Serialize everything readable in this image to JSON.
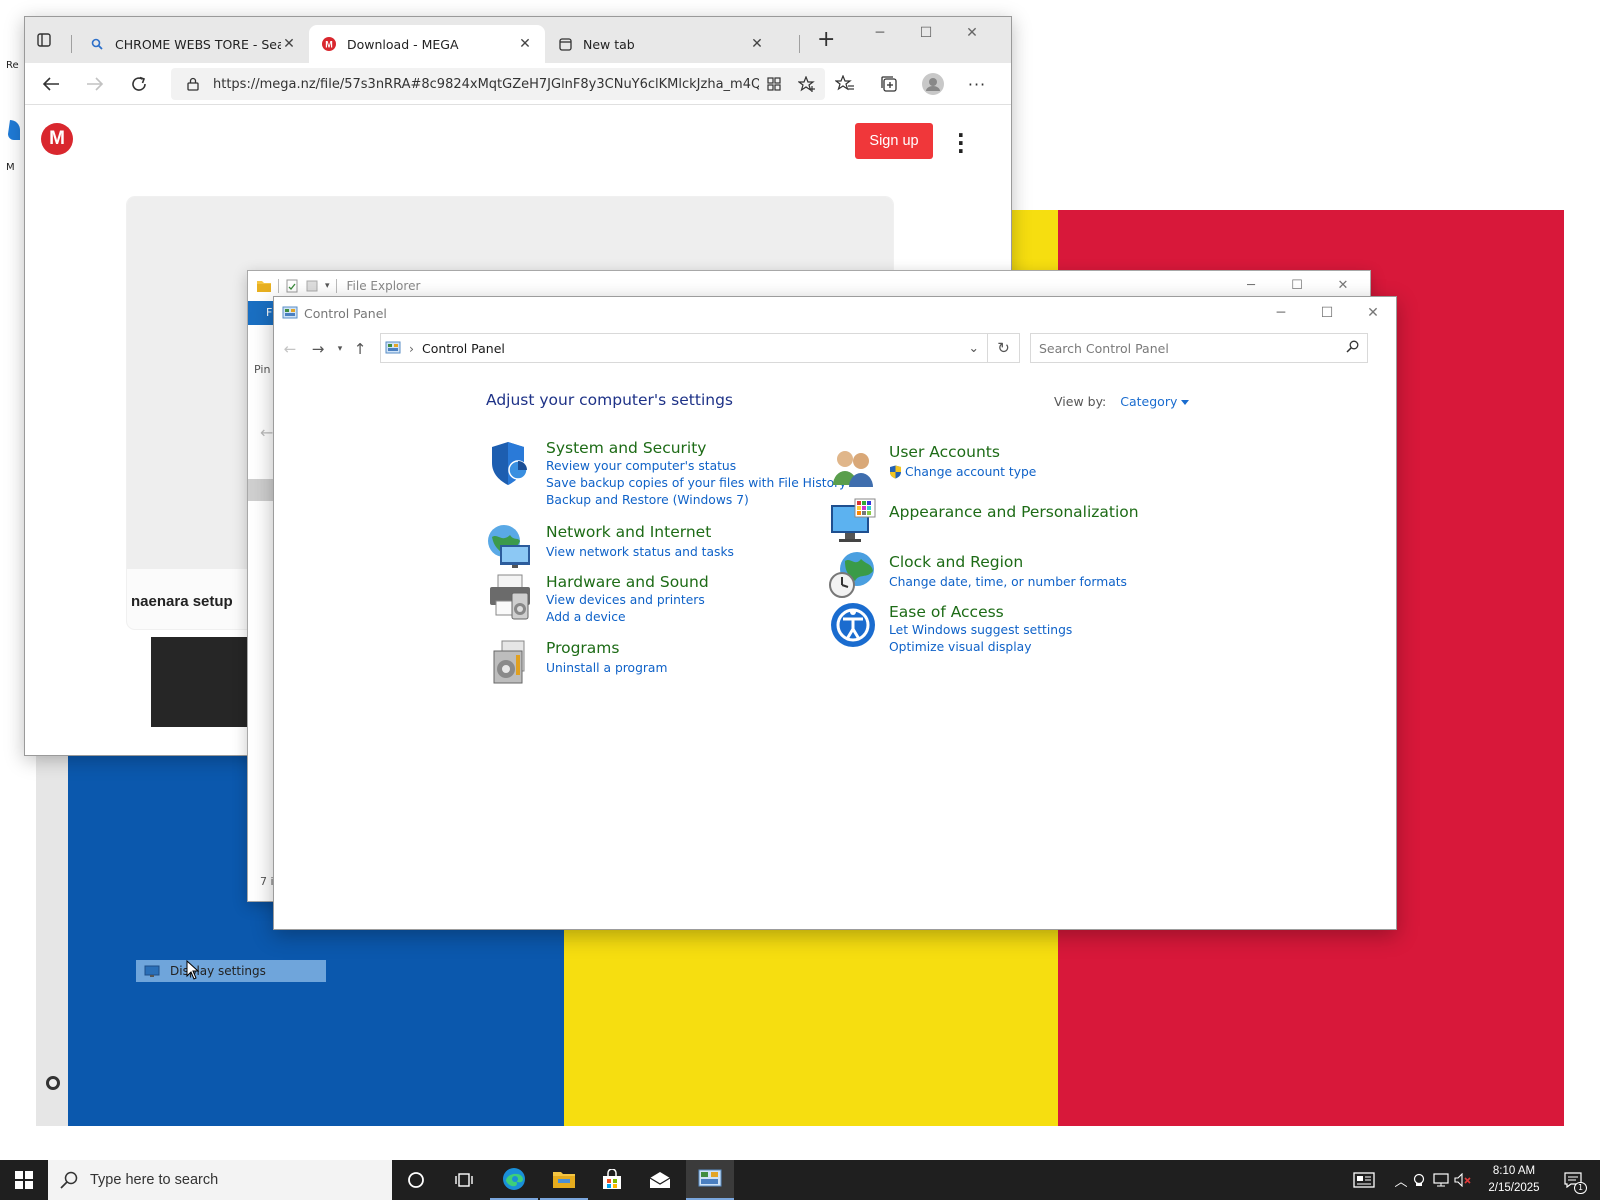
{
  "browser": {
    "tabs": [
      {
        "title": "CHROME WEBS TORE - Search",
        "close": "✕"
      },
      {
        "title": "Download - MEGA",
        "close": "✕"
      },
      {
        "title": "New tab",
        "close": "✕"
      }
    ],
    "new_tab": "+",
    "url": "https://mega.nz/file/57s3nRRA#8c9824xMqtGZeH7JGlnF8y3CNuY6clKMlckJzha_m4Q",
    "page": {
      "logo_letter": "M",
      "signup_label": "Sign up",
      "file_name": "naenara setup"
    }
  },
  "explorer": {
    "title": "File Explorer",
    "ribbon_tab_fragment": "F",
    "pin_fragment": "Pin",
    "status_fragment": "7 i"
  },
  "control_panel": {
    "title": "Control Panel",
    "breadcrumb": "Control Panel",
    "search_placeholder": "Search Control Panel",
    "heading": "Adjust your computer's settings",
    "view_by_label": "View by:",
    "view_by_value": "Category",
    "categories_left": [
      {
        "title": "System and Security",
        "links": [
          "Review your computer's status",
          "Save backup copies of your files with File History",
          "Backup and Restore (Windows 7)"
        ]
      },
      {
        "title": "Network and Internet",
        "links": [
          "View network status and tasks"
        ]
      },
      {
        "title": "Hardware and Sound",
        "links": [
          "View devices and printers",
          "Add a device"
        ]
      },
      {
        "title": "Programs",
        "links": [
          "Uninstall a program"
        ]
      }
    ],
    "categories_right": [
      {
        "title": "User Accounts",
        "links": [
          "Change account type"
        ]
      },
      {
        "title": "Appearance and Personalization",
        "links": []
      },
      {
        "title": "Clock and Region",
        "links": [
          "Change date, time, or number formats"
        ]
      },
      {
        "title": "Ease of Access",
        "links": [
          "Let Windows suggest settings",
          "Optimize visual display"
        ]
      }
    ]
  },
  "desktop": {
    "drag_label": "Display settings",
    "icon_fragments": [
      "Re",
      "M"
    ]
  },
  "taskbar": {
    "search_placeholder": "Type here to search",
    "time": "8:10 AM",
    "date": "2/15/2025",
    "notification_count": "1"
  },
  "colors": {
    "flag_blue": "#0b58ad",
    "flag_yellow": "#f6de10",
    "flag_red": "#d8183a",
    "mega_red": "#d9272e",
    "signup_red": "#f0373a",
    "cp_category_green": "#1d6b16",
    "cp_link_blue": "#0f62c8",
    "taskbar": "#1f1f1f"
  }
}
